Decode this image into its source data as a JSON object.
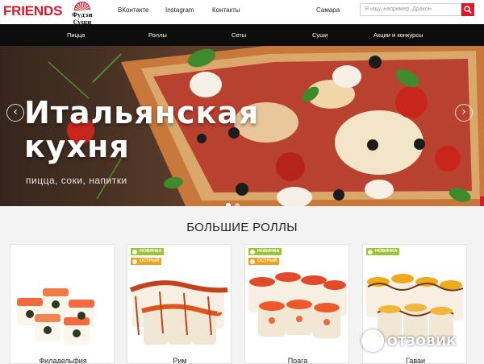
{
  "header": {
    "logo_text": "FRIENDS",
    "brand_logo_text": "Фудзи Суши",
    "nav": [
      {
        "label": "ВКонтакте"
      },
      {
        "label": "Instagram"
      },
      {
        "label": "Контакты"
      }
    ],
    "city": "Самара",
    "search": {
      "placeholder": "Я ищу, например, Дракон"
    }
  },
  "categories": [
    {
      "label": "Пицца"
    },
    {
      "label": "Роллы"
    },
    {
      "label": "Сеты"
    },
    {
      "label": "Суши"
    },
    {
      "label": "Акции и конкурсы"
    }
  ],
  "hero": {
    "title_line1": "Итальянская",
    "title_line2": "кухня",
    "subtitle": "пицца, соки, напитки",
    "prev_arrow": "‹",
    "next_arrow": "›",
    "slides_count": 2,
    "active_slide": 1
  },
  "section": {
    "title": "БОЛЬШИЕ РОЛЛЫ"
  },
  "products": [
    {
      "name": "Филадельфия",
      "badges": []
    },
    {
      "name": "Рим",
      "badges": [
        {
          "type": "new",
          "label": "НОВИНКА"
        },
        {
          "type": "hot",
          "label": "ОСТРЫЙ"
        }
      ]
    },
    {
      "name": "Прага",
      "badges": [
        {
          "type": "new",
          "label": "НОВИНКА"
        },
        {
          "type": "hot",
          "label": "ОСТРЫЙ"
        }
      ]
    },
    {
      "name": "Гаваи",
      "badges": [
        {
          "type": "new",
          "label": "НОВИНКА"
        }
      ]
    }
  ],
  "watermark": {
    "text": "ОТЗОВИК"
  },
  "colors": {
    "brand_red": "#d8182b",
    "category_bar": "#0d0d0d",
    "badge_new": "#9bc43a",
    "badge_hot": "#f0a21e"
  }
}
